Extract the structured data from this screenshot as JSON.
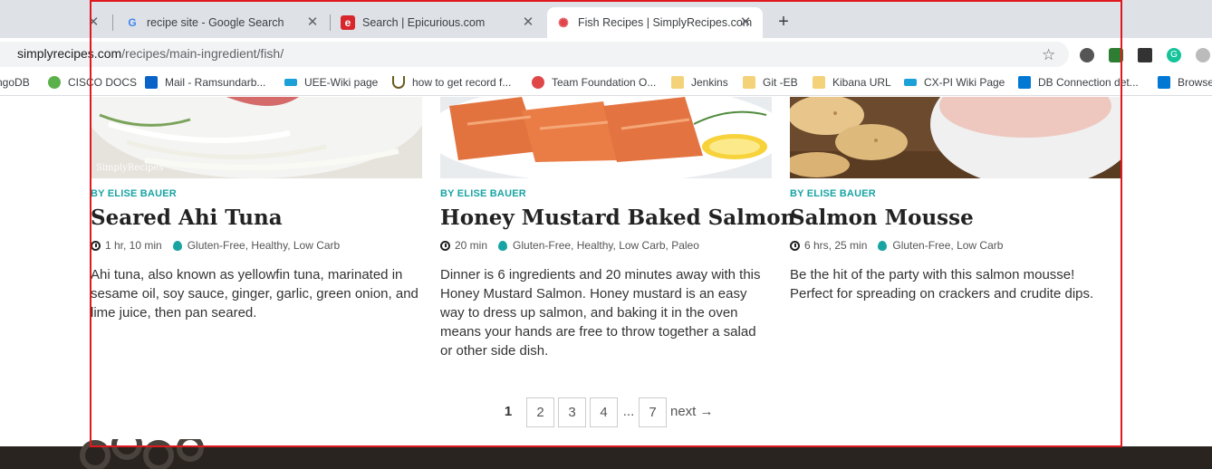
{
  "browser": {
    "tabs": [
      {
        "title": "",
        "favicon": "blank"
      },
      {
        "title": "recipe site - Google Search",
        "favicon": "google-icon"
      },
      {
        "title": "Search | Epicurious.com",
        "favicon": "epicurious-icon"
      },
      {
        "title": "Fish Recipes | SimplyRecipes.com",
        "favicon": "simplyrecipes-icon",
        "active": true
      }
    ],
    "new_tab": "+",
    "close_glyph": "✕",
    "url_domain": "simplyrecipes.com",
    "url_path": "/recipes/main-ingredient/fish/",
    "bookmarks": [
      {
        "label": "ngoDB",
        "icon": "mongodb-icon",
        "color": "#ffffff"
      },
      {
        "label": "CISCO DOCS",
        "icon": "cisco-docs-icon",
        "color": "#5bb04a"
      },
      {
        "label": "Mail - Ramsundarb...",
        "icon": "outlook-icon",
        "color": "#0a64c8"
      },
      {
        "label": "UEE-Wiki page",
        "icon": "cisco-icon",
        "color": "#1ba0d7"
      },
      {
        "label": "how to get record f...",
        "icon": "horseshoe-icon",
        "color": "#6b5a20"
      },
      {
        "label": "Team Foundation O...",
        "icon": "tfs-icon",
        "color": "#e04848"
      },
      {
        "label": "Jenkins",
        "icon": "folder-icon",
        "color": "#f4d27a"
      },
      {
        "label": "Git -EB",
        "icon": "folder-icon",
        "color": "#f4d27a"
      },
      {
        "label": "Kibana URL",
        "icon": "folder-icon",
        "color": "#f4d27a"
      },
      {
        "label": "CX-PI Wiki Page",
        "icon": "cisco-icon",
        "color": "#1ba0d7"
      },
      {
        "label": "DB Connection det...",
        "icon": "azure-icon",
        "color": "#0078d4"
      },
      {
        "label": "Browse",
        "icon": "azure-icon",
        "color": "#0078d4"
      }
    ]
  },
  "cards": [
    {
      "byline": "BY ELISE BAUER",
      "title": "Seared Ahi Tuna",
      "time": "1 hr, 10 min",
      "tags": "Gluten-Free, Healthy, Low Carb",
      "description": "Ahi tuna, also known as yellowfin tuna, marinated in sesame oil, soy sauce, ginger, garlic, green onion, and lime juice, then pan seared.",
      "image_watermark": "SimplyRecipes"
    },
    {
      "byline": "BY ELISE BAUER",
      "title": "Honey Mustard Baked Salmon",
      "time": "20 min",
      "tags": "Gluten-Free, Healthy, Low Carb, Paleo",
      "description": "Dinner is 6 ingredients and 20 minutes away with this Honey Mustard Salmon. Honey mustard is an easy way to dress up salmon, and baking it in the oven means your hands are free to throw together a salad or other side dish."
    },
    {
      "byline": "BY ELISE BAUER",
      "title": "Salmon Mousse",
      "time": "6 hrs, 25 min",
      "tags": "Gluten-Free, Low Carb",
      "description": "Be the hit of the party with this salmon mousse! Perfect for spreading on crackers and crudite dips."
    }
  ],
  "pagination": {
    "current": "1",
    "pages": [
      "2",
      "3",
      "4"
    ],
    "ellipsis": "...",
    "last": "7",
    "next": "next →"
  },
  "colors": {
    "accent": "#19a3a3",
    "highlight_box": "#e0191f",
    "footer": "#2a2420"
  }
}
